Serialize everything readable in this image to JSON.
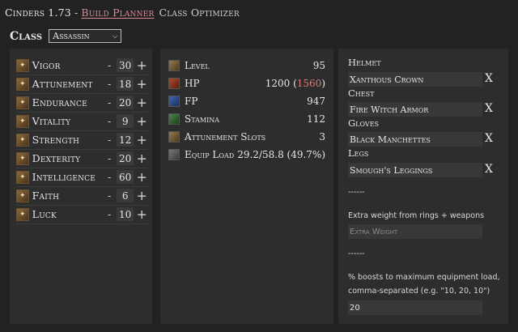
{
  "nav": {
    "app_title": "Cinders 1.73",
    "separator": "-",
    "build_planner": "Build Planner",
    "class_optimizer": "Class Optimizer"
  },
  "class": {
    "label": "Class",
    "selected": "Assassin"
  },
  "stats": [
    {
      "name": "Vigor",
      "value": "30",
      "icon": "vigor-icon"
    },
    {
      "name": "Attunement",
      "value": "18",
      "icon": "attunement-icon"
    },
    {
      "name": "Endurance",
      "value": "20",
      "icon": "endurance-icon"
    },
    {
      "name": "Vitality",
      "value": "9",
      "icon": "vitality-icon"
    },
    {
      "name": "Strength",
      "value": "12",
      "icon": "strength-icon"
    },
    {
      "name": "Dexterity",
      "value": "20",
      "icon": "dexterity-icon"
    },
    {
      "name": "Intelligence",
      "value": "60",
      "icon": "intelligence-icon"
    },
    {
      "name": "Faith",
      "value": "6",
      "icon": "faith-icon"
    },
    {
      "name": "Luck",
      "value": "10",
      "icon": "luck-icon"
    }
  ],
  "stat_controls": {
    "minus": "-",
    "plus": "+"
  },
  "derived": [
    {
      "label": "Level",
      "value": "95"
    },
    {
      "label": "HP",
      "value": "1200",
      "extra": "1560"
    },
    {
      "label": "FP",
      "value": "947"
    },
    {
      "label": "Stamina",
      "value": "112"
    },
    {
      "label": "Attunement Slots",
      "value": "3"
    },
    {
      "label": "Equip Load",
      "value": "29.2/58.8 (49.7%)"
    }
  ],
  "equipment": {
    "helmet_label": "Helmet",
    "helmet_value": "Xanthous Crown",
    "chest_label": "Chest",
    "chest_value": "Fire Witch Armor",
    "gloves_label": "Gloves",
    "gloves_value": "Black Manchettes",
    "legs_label": "Legs",
    "legs_value": "Smough's Leggings",
    "clear": "X",
    "divider1": "------",
    "extra_weight_label": "Extra weight from rings + weapons",
    "extra_weight_placeholder": "Extra Weight",
    "divider2": "------",
    "boost_label_1": "% boosts to maximum equipment load,",
    "boost_label_2": "comma-separated (e.g. \"10, 20, 10\")",
    "boost_value": "20"
  },
  "colors": {
    "accent": "#d98a95",
    "hp_extra": "#e07a7a",
    "background": "#222222",
    "panel": "#2d2d2d"
  }
}
